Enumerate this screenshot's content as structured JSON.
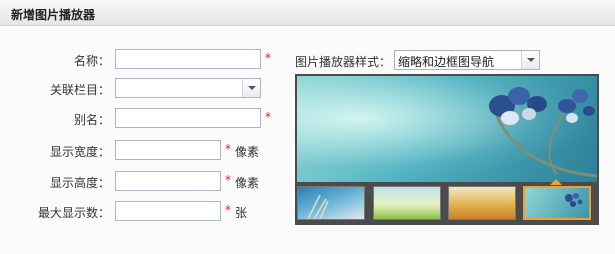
{
  "header": {
    "title": "新增图片播放器"
  },
  "form": {
    "name": {
      "label": "名称：",
      "value": "",
      "required": "*"
    },
    "column": {
      "label": "关联栏目：",
      "value": ""
    },
    "alias": {
      "label": "别名：",
      "value": "",
      "required": "*"
    },
    "width": {
      "label": "显示宽度：",
      "value": "",
      "required": "*",
      "unit": "像素"
    },
    "height": {
      "label": "显示高度：",
      "value": "",
      "required": "*",
      "unit": "像素"
    },
    "max": {
      "label": "最大显示数：",
      "value": "",
      "required": "*",
      "unit": "张"
    }
  },
  "player_style": {
    "label": "图片播放器样式：",
    "selected": "缩略和边框图导航"
  },
  "preview": {
    "thumbnail_count": 4,
    "active_thumbnail": 4
  },
  "colors": {
    "required": "#e02020",
    "active_thumb_border": "#f0a030",
    "preview_frame": "#4b4b4b"
  }
}
